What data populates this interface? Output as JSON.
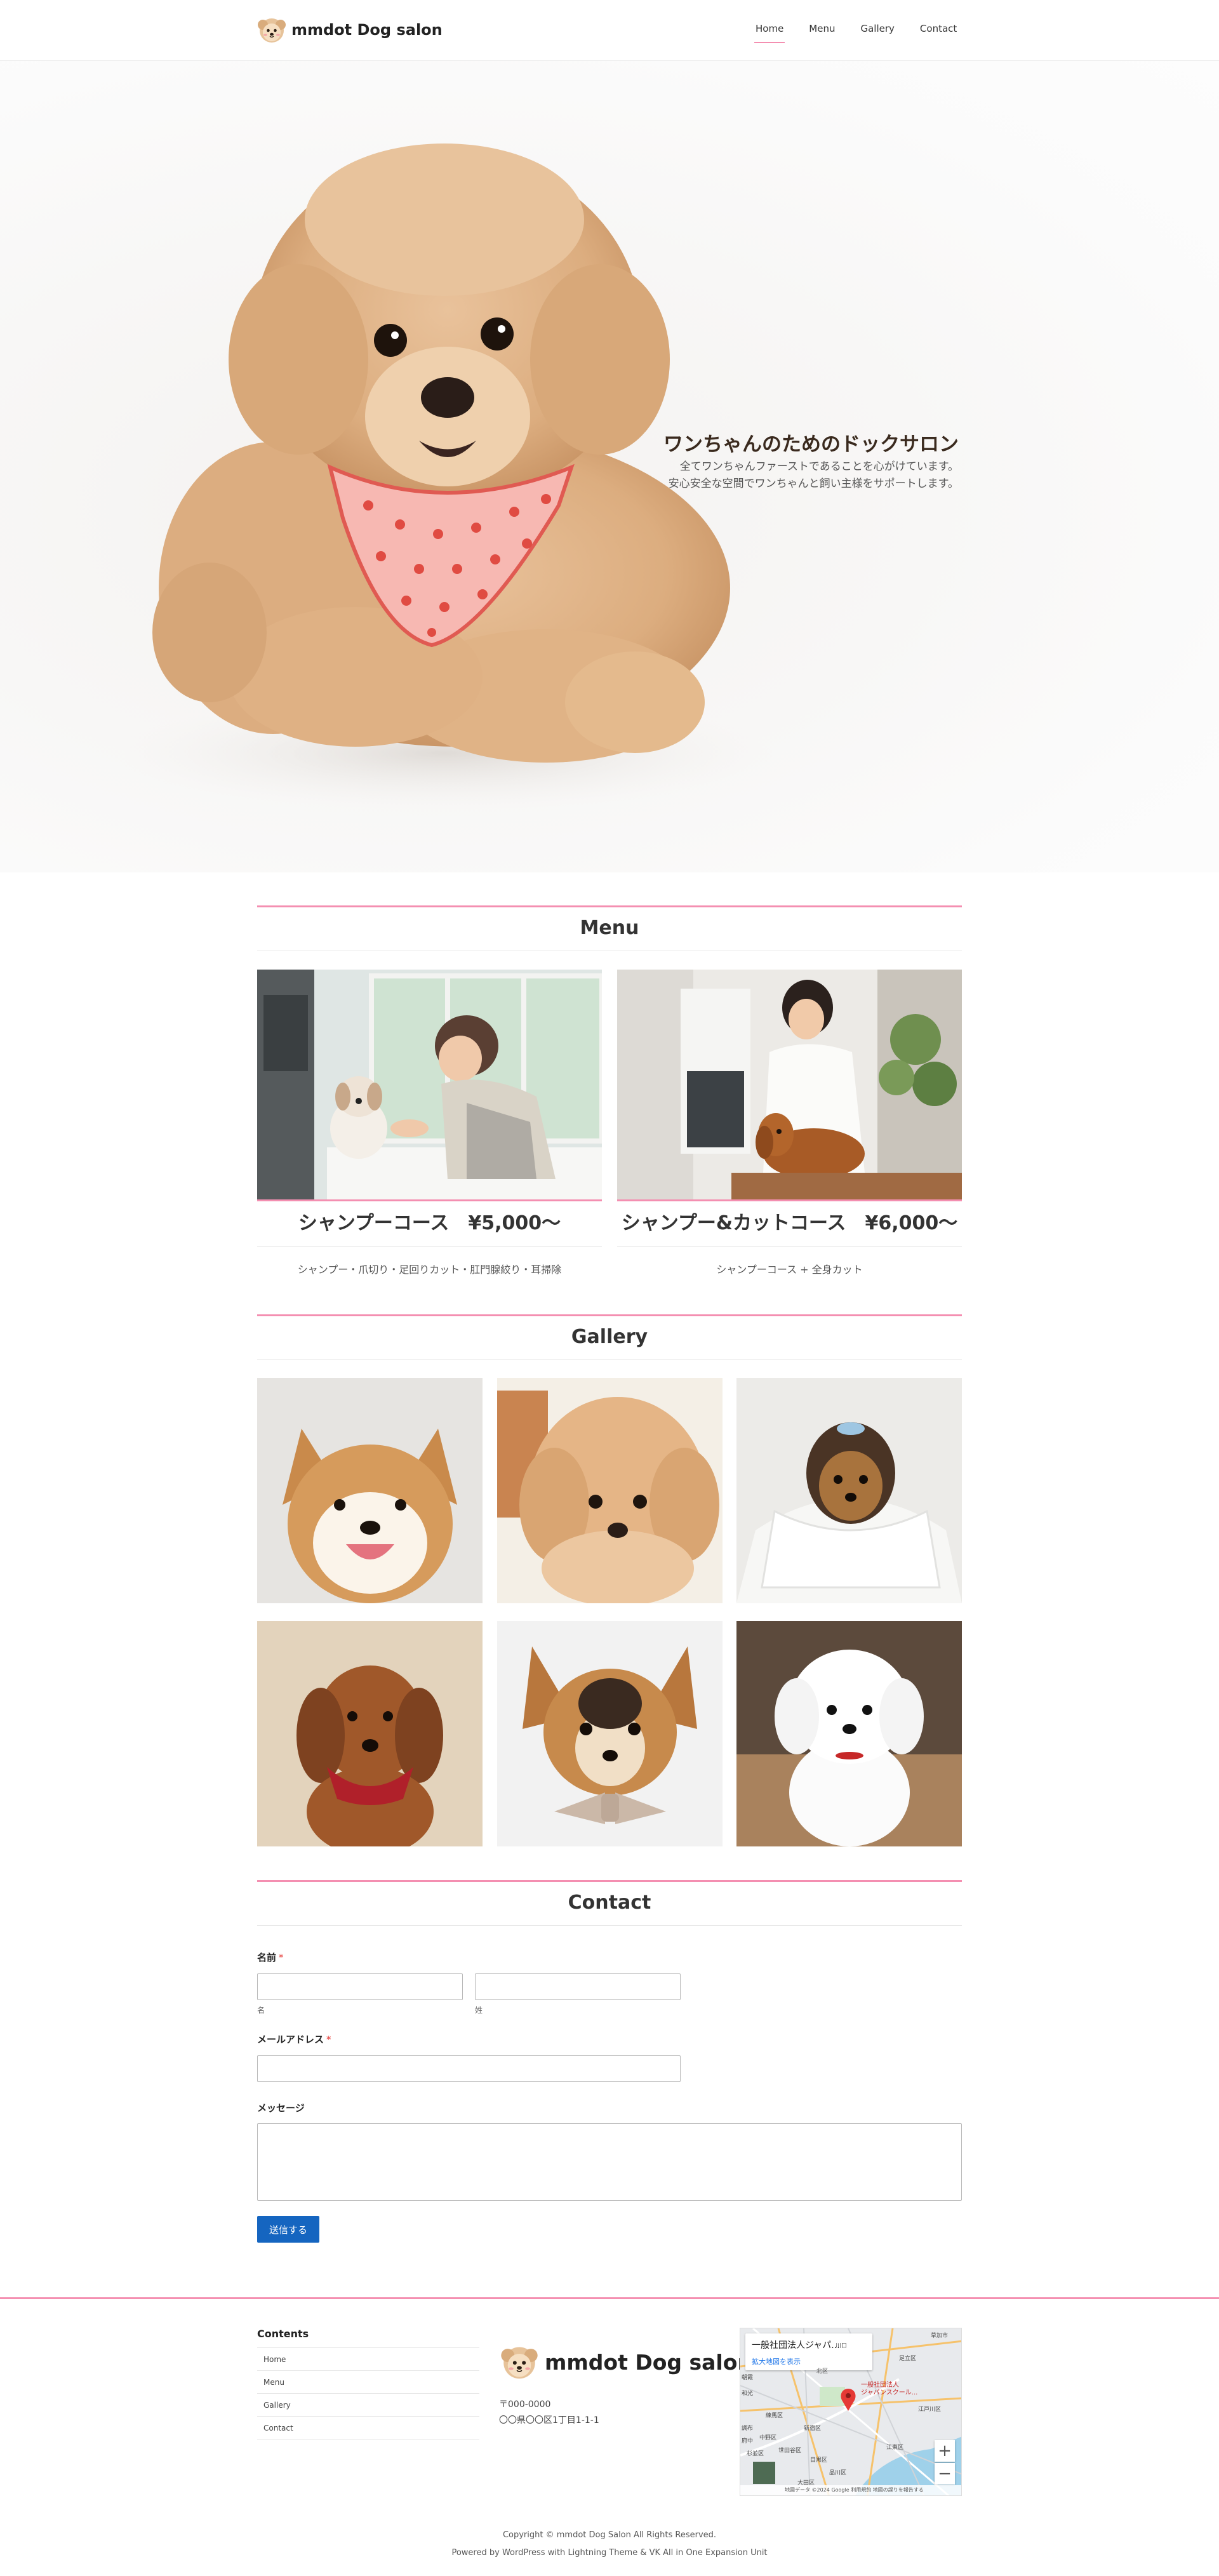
{
  "header": {
    "brand": "mmdot Dog salon",
    "nav": [
      {
        "label": "Home",
        "current": true
      },
      {
        "label": "Menu",
        "current": false
      },
      {
        "label": "Gallery",
        "current": false
      },
      {
        "label": "Contact",
        "current": false
      }
    ]
  },
  "hero": {
    "title": "ワンちゃんのためのドックサロン",
    "line1": "全てワンちゃんファーストであることを心がけています。",
    "line2": "安心安全な空間でワンちゃんと飼い主様をサポートします。"
  },
  "menu": {
    "title": "Menu",
    "items": [
      {
        "title": "シャンプーコース　¥5,000〜",
        "desc": "シャンプー・爪切り・足回りカット・肛門腺絞り・耳掃除"
      },
      {
        "title": "シャンプー&カットコース　¥6,000〜",
        "desc": "シャンプーコース + 全身カット"
      }
    ]
  },
  "gallery": {
    "title": "Gallery",
    "images": [
      "shiba-dog-photo",
      "toy-poodle-photo",
      "yorkshire-terrier-photo",
      "dachshund-photo",
      "chihuahua-photo",
      "maltese-photo"
    ]
  },
  "contact": {
    "title": "Contact",
    "name_label": "名前",
    "required_mark": "*",
    "first_sub": "名",
    "last_sub": "姓",
    "email_label": "メールアドレス",
    "message_label": "メッセージ",
    "submit_label": "送信する",
    "first_value": "",
    "last_value": "",
    "email_value": "",
    "message_value": ""
  },
  "footer": {
    "contents_title": "Contents",
    "links": [
      "Home",
      "Menu",
      "Gallery",
      "Contact"
    ],
    "brand": "mmdot Dog salon",
    "postal": "〒000-0000",
    "address": "〇〇県〇〇区1丁目1-1-1",
    "map": {
      "place_name": "一般社団法人ジャパ...",
      "larger_map_link": "拡大地図を表示",
      "marker_label_1": "一般社団法人",
      "marker_label_2": "ジャパンスクール...",
      "zoom_in": "+",
      "zoom_out": "−",
      "attribution": "地図データ ©2024 Google  利用規約  地図の誤りを報告する",
      "labels": [
        "草加市",
        "川口",
        "北区",
        "足立区",
        "朝霞",
        "和光",
        "練馬区",
        "新宿区",
        "中野区",
        "杉並区",
        "江東区",
        "世田谷区",
        "目黒区",
        "品川区",
        "大田区",
        "調布",
        "府中",
        "江戸川区"
      ]
    },
    "copyright": "Copyright © mmdot Dog Salon All Rights Reserved.",
    "powered_prefix": "Powered by ",
    "powered_wp": "WordPress",
    "powered_mid": " with ",
    "powered_theme": "Lightning Theme",
    "powered_amp": " & ",
    "powered_vk": "VK All in One Expansion Unit"
  },
  "colors": {
    "accent_pink": "#f48fb1",
    "submit_blue": "#1565c0",
    "required_red": "#e53935"
  }
}
